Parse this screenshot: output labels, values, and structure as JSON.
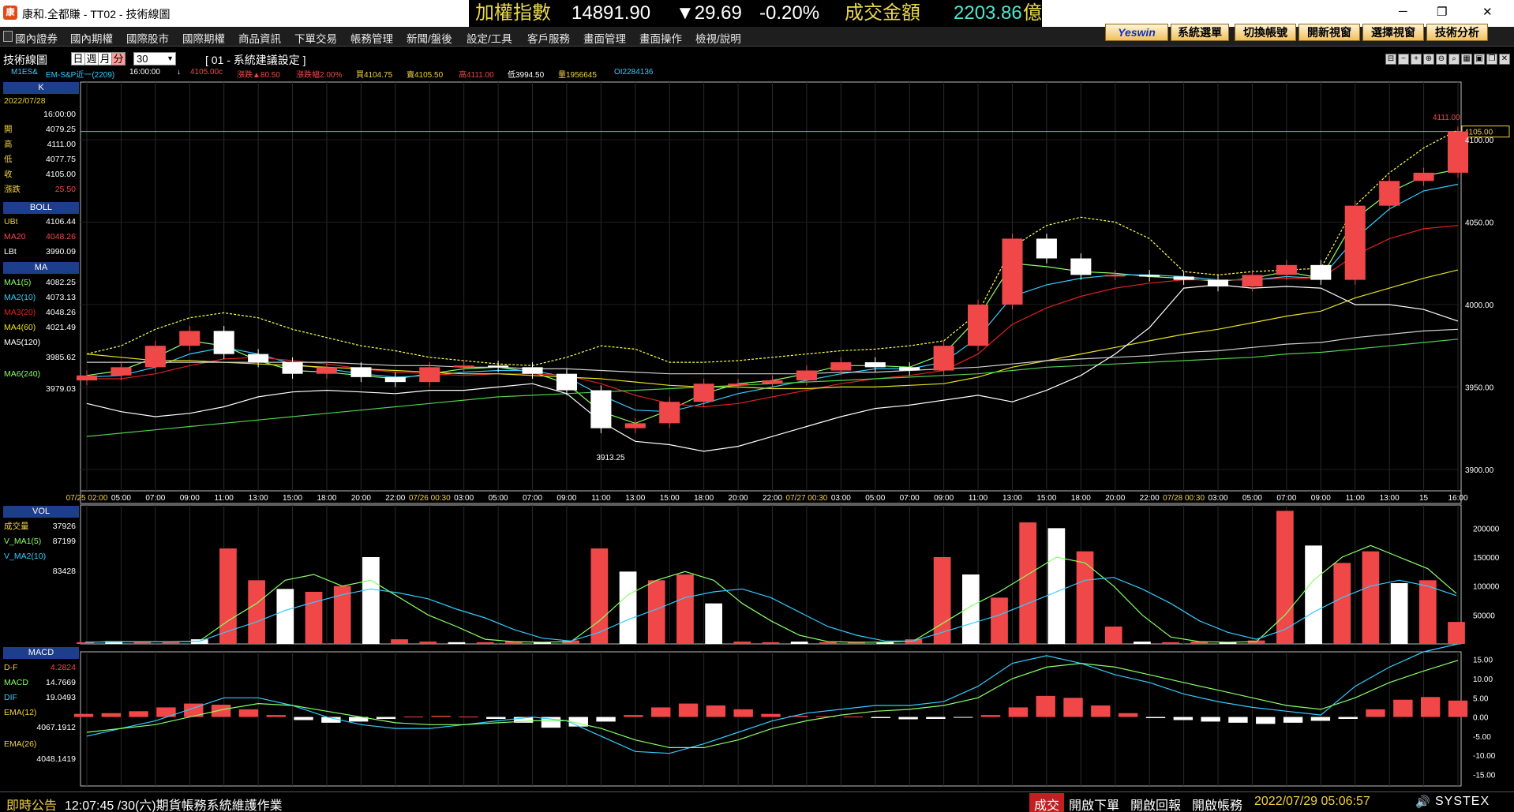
{
  "window": {
    "logo_text": "康",
    "title": "康和.全都賺 - TT02 - 技術線圖",
    "minimize": "─",
    "maximize": "❐",
    "close": "✕"
  },
  "ticker": {
    "index_name": "加權指數",
    "index_value": "14891.90",
    "change": "▼29.69",
    "change_pct": "-0.20%",
    "turnover_label": "成交金額",
    "turnover_value": "2203.86",
    "turnover_unit": "億"
  },
  "menu": [
    "國內證券",
    "國內期權",
    "國際股市",
    "國際期權",
    "商品資訊",
    "下單交易",
    "帳務管理",
    "新聞/盤後",
    "設定/工具",
    "客戶服務",
    "畫面管理",
    "畫面操作",
    "檢視/說明"
  ],
  "toolbar_buttons": [
    "Yeswin",
    "系統選單",
    "切換帳號",
    "開新視窗",
    "選擇視窗",
    "技術分析"
  ],
  "chart_header": {
    "title": "技術線圖",
    "periods": [
      "日",
      "週",
      "月",
      "分"
    ],
    "active_period": "分",
    "interval_value": "30",
    "settings_label": "[ 01 - 系統建議設定 ]"
  },
  "info": {
    "symbol": "M1ES&",
    "name": "EM-S&P近一(2209)",
    "time": "16:00:00",
    "arrow": "↓",
    "price": "4105.00c",
    "change": "漲跌▲80.50",
    "change_pct": "漲跌幅2.00%",
    "bid": "買4104.75",
    "ask": "賣4105.50",
    "high": "高4111.00",
    "low": "低3994.50",
    "volume": "量1956645",
    "oi": "OI2284136"
  },
  "left_panel": {
    "k_header": "K",
    "date": "2022/07/28",
    "time": "16:00:00",
    "ohlc": [
      {
        "k": "開",
        "v": "4079.25"
      },
      {
        "k": "高",
        "v": "4111.00"
      },
      {
        "k": "低",
        "v": "4077.75"
      },
      {
        "k": "收",
        "v": "4105.00"
      },
      {
        "k": "漲跌",
        "v": "25.50"
      }
    ],
    "boll_header": "BOLL",
    "boll": [
      {
        "k": "UBt",
        "v": "4106.44"
      },
      {
        "k": "MA20",
        "v": "4048.26"
      },
      {
        "k": "LBt",
        "v": "3990.09"
      }
    ],
    "ma_header": "MA",
    "ma": [
      {
        "k": "MA1(5)",
        "v": "4082.25"
      },
      {
        "k": "MA2(10)",
        "v": "4073.13"
      },
      {
        "k": "MA3(20)",
        "v": "4048.26"
      },
      {
        "k": "MA4(60)",
        "v": "4021.49"
      },
      {
        "k": "MA5(120)",
        "v": ""
      },
      {
        "k": "",
        "v": "3985.62"
      },
      {
        "k": "MA6(240)",
        "v": ""
      },
      {
        "k": "",
        "v": "3979.03"
      }
    ],
    "vol_header": "VOL",
    "vol": [
      {
        "k": "成交量",
        "v": "37926"
      },
      {
        "k": "V_MA1(5)",
        "v": "87199"
      },
      {
        "k": "V_MA2(10)",
        "v": ""
      },
      {
        "k": "",
        "v": "83428"
      }
    ],
    "macd_header": "MACD",
    "macd": [
      {
        "k": "D-F",
        "v": "4.2824"
      },
      {
        "k": "MACD",
        "v": "14.7669"
      },
      {
        "k": "DIF",
        "v": "19.0493"
      },
      {
        "k": "EMA(12)",
        "v": ""
      },
      {
        "k": "",
        "v": "4067.1912"
      },
      {
        "k": "EMA(26)",
        "v": ""
      },
      {
        "k": "",
        "v": "4048.1419"
      }
    ]
  },
  "chart_data": [
    {
      "type": "candlestick",
      "x": [
        "07/25 02:00",
        "05:00",
        "07:00",
        "09:00",
        "11:00",
        "13:00",
        "15:00",
        "18:00",
        "20:00",
        "22:00",
        "07/26 00:30",
        "03:00",
        "05:00",
        "07:00",
        "09:00",
        "11:00",
        "13:00",
        "15:00",
        "18:00",
        "20:00",
        "22:00",
        "07/27 00:30",
        "03:00",
        "05:00",
        "07:00",
        "09:00",
        "11:00",
        "13:00",
        "15:00",
        "18:00",
        "20:00",
        "22:00",
        "07/28 00:30",
        "03:00",
        "05:00",
        "07:00",
        "09:00",
        "11:00",
        "13:00",
        "15",
        "16:00"
      ],
      "y_ticks": [
        "4100.00",
        "4050.00",
        "4000.00",
        "3950.00",
        "3900.00"
      ],
      "ylim": [
        3887,
        4135
      ],
      "last_price": "4105.00",
      "high_label": "4111.00",
      "low_label": "3913.25",
      "series": [
        {
          "name": "K",
          "values_close": [
            3957,
            3962,
            3975,
            3984,
            3970,
            3965,
            3958,
            3962,
            3956,
            3953,
            3962,
            3963,
            3962,
            3958,
            3948,
            3925,
            3928,
            3941,
            3952,
            3952,
            3954,
            3960,
            3965,
            3962,
            3960,
            3975,
            4000,
            4040,
            4028,
            4018,
            4018,
            4017,
            4015,
            4011,
            4018,
            4024,
            4015,
            4060,
            4075,
            4080,
            4105
          ]
        },
        {
          "name": "MA1(5)",
          "values": [
            3957,
            3960,
            3968,
            3978,
            3975,
            3966,
            3960,
            3959,
            3957,
            3955,
            3958,
            3961,
            3962,
            3959,
            3952,
            3935,
            3928,
            3936,
            3946,
            3952,
            3954,
            3958,
            3963,
            3963,
            3962,
            3970,
            3992,
            4025,
            4023,
            4020,
            4019,
            4017,
            4016,
            4014,
            4016,
            4020,
            4016,
            4052,
            4068,
            4078,
            4082
          ]
        },
        {
          "name": "MA2(10)",
          "values": [
            3956,
            3957,
            3962,
            3970,
            3974,
            3970,
            3964,
            3961,
            3958,
            3956,
            3957,
            3959,
            3960,
            3960,
            3956,
            3945,
            3936,
            3935,
            3940,
            3946,
            3950,
            3954,
            3958,
            3961,
            3961,
            3965,
            3980,
            4005,
            4012,
            4016,
            4018,
            4018,
            4017,
            4015,
            4015,
            4017,
            4016,
            4040,
            4058,
            4069,
            4073
          ]
        },
        {
          "name": "MA3(20)",
          "values": [
            3955,
            3955,
            3958,
            3963,
            3967,
            3968,
            3966,
            3964,
            3961,
            3959,
            3958,
            3957,
            3958,
            3958,
            3957,
            3952,
            3945,
            3940,
            3938,
            3940,
            3944,
            3948,
            3952,
            3955,
            3957,
            3960,
            3970,
            3988,
            3998,
            4005,
            4010,
            4013,
            4015,
            4015,
            4015,
            4016,
            4016,
            4030,
            4040,
            4046,
            4048
          ]
        },
        {
          "name": "MA4(60)",
          "values": [
            3970,
            3968,
            3966,
            3966,
            3965,
            3964,
            3963,
            3962,
            3961,
            3960,
            3959,
            3958,
            3958,
            3957,
            3956,
            3955,
            3953,
            3951,
            3950,
            3950,
            3949,
            3949,
            3950,
            3950,
            3951,
            3952,
            3956,
            3962,
            3966,
            3970,
            3974,
            3978,
            3982,
            3985,
            3989,
            3993,
            3996,
            4004,
            4010,
            4016,
            4021
          ]
        },
        {
          "name": "MA5(120)",
          "values": [
            3965,
            3965,
            3965,
            3965,
            3965,
            3965,
            3965,
            3965,
            3964,
            3963,
            3963,
            3962,
            3962,
            3961,
            3961,
            3960,
            3959,
            3958,
            3958,
            3958,
            3958,
            3958,
            3959,
            3959,
            3960,
            3961,
            3962,
            3964,
            3966,
            3967,
            3968,
            3969,
            3971,
            3972,
            3974,
            3976,
            3977,
            3980,
            3982,
            3984,
            3985
          ]
        },
        {
          "name": "MA6(240)",
          "values": [
            3920,
            3922,
            3924,
            3926,
            3928,
            3930,
            3932,
            3934,
            3936,
            3938,
            3940,
            3942,
            3944,
            3945,
            3946,
            3947,
            3948,
            3949,
            3950,
            3951,
            3952,
            3953,
            3954,
            3955,
            3956,
            3957,
            3958,
            3960,
            3962,
            3963,
            3964,
            3965,
            3966,
            3967,
            3968,
            3970,
            3971,
            3973,
            3975,
            3977,
            3979
          ]
        },
        {
          "name": "UBt",
          "values": [
            3970,
            3975,
            3985,
            3992,
            3995,
            3992,
            3985,
            3980,
            3975,
            3972,
            3968,
            3966,
            3964,
            3963,
            3968,
            3975,
            3973,
            3965,
            3965,
            3966,
            3968,
            3970,
            3972,
            3973,
            3975,
            3978,
            3995,
            4035,
            4048,
            4053,
            4050,
            4040,
            4020,
            4018,
            4020,
            4021,
            4022,
            4060,
            4080,
            4095,
            4106
          ]
        },
        {
          "name": "LBt",
          "values": [
            3940,
            3935,
            3932,
            3934,
            3938,
            3944,
            3947,
            3948,
            3947,
            3946,
            3948,
            3948,
            3950,
            3952,
            3946,
            3929,
            3917,
            3915,
            3911,
            3914,
            3920,
            3926,
            3932,
            3937,
            3939,
            3942,
            3945,
            3941,
            3948,
            3957,
            3970,
            3986,
            4010,
            4012,
            4010,
            4011,
            4010,
            4000,
            4000,
            3997,
            3990
          ]
        }
      ]
    },
    {
      "type": "bar",
      "name": "VOL",
      "y_ticks": [
        "200000",
        "150000",
        "100000",
        "50000"
      ],
      "ylim": [
        0,
        240000
      ],
      "values": [
        3000,
        5000,
        4000,
        3000,
        8000,
        165000,
        110000,
        95000,
        90000,
        100000,
        150000,
        8000,
        4000,
        3000,
        3000,
        4000,
        3000,
        6000,
        165000,
        125000,
        110000,
        120000,
        70000,
        4000,
        3000,
        4000,
        3000,
        3000,
        3000,
        8000,
        150000,
        120000,
        80000,
        210000,
        200000,
        160000,
        30000,
        4000,
        3000,
        4000,
        3000,
        6000,
        230000,
        170000,
        140000,
        160000,
        105000,
        110000,
        38000
      ],
      "series": [
        {
          "name": "V_MA1(5)",
          "values": [
            3000,
            4000,
            4000,
            4000,
            5000,
            40000,
            70000,
            110000,
            120000,
            100000,
            110000,
            80000,
            50000,
            30000,
            8000,
            4000,
            3000,
            4000,
            40000,
            85000,
            110000,
            125000,
            110000,
            70000,
            40000,
            15000,
            4000,
            3000,
            3000,
            5000,
            35000,
            65000,
            90000,
            120000,
            150000,
            140000,
            100000,
            50000,
            12000,
            4000,
            3000,
            4000,
            50000,
            110000,
            150000,
            170000,
            150000,
            130000,
            87199
          ]
        },
        {
          "name": "V_MA2(10)",
          "values": [
            3000,
            3500,
            3800,
            4000,
            4500,
            22000,
            38000,
            58000,
            72000,
            85000,
            95000,
            88000,
            78000,
            60000,
            45000,
            25000,
            10000,
            5000,
            20000,
            42000,
            60000,
            80000,
            90000,
            95000,
            80000,
            55000,
            30000,
            15000,
            5000,
            5000,
            20000,
            35000,
            50000,
            70000,
            90000,
            110000,
            115000,
            95000,
            70000,
            40000,
            20000,
            8000,
            25000,
            55000,
            80000,
            100000,
            110000,
            100000,
            83428
          ]
        }
      ]
    },
    {
      "type": "bar",
      "name": "MACD",
      "y_ticks": [
        "15.00",
        "10.00",
        "5.00",
        "0.00",
        "-5.00",
        "-10.00",
        "-15.00"
      ],
      "ylim": [
        -18,
        17
      ],
      "values": [
        0.8,
        1.0,
        1.5,
        2.5,
        3.5,
        3.2,
        2.0,
        0.5,
        -0.8,
        -1.5,
        -1.2,
        -0.5,
        0.1,
        0.3,
        0.1,
        -0.5,
        -1.5,
        -2.8,
        -2.5,
        -1.2,
        0.5,
        2.5,
        3.5,
        3.0,
        2.0,
        0.8,
        0.3,
        0.2,
        0.1,
        -0.3,
        -0.6,
        -0.5,
        -0.2,
        0.5,
        2.5,
        5.5,
        5.0,
        3.0,
        1.0,
        -0.3,
        -0.8,
        -1.2,
        -1.5,
        -1.8,
        -1.5,
        -1.0,
        -0.5,
        2.0,
        4.5,
        5.2,
        4.28
      ],
      "series": [
        {
          "name": "DIF",
          "values": [
            -5,
            -3,
            -1,
            2,
            5,
            5,
            3,
            0,
            -2,
            -3,
            -3,
            -2,
            -1,
            0,
            -1,
            -5,
            -9,
            -9.5,
            -7,
            -4,
            -1,
            1,
            2,
            3,
            3,
            4,
            8,
            14,
            16,
            14,
            11,
            9,
            6,
            4,
            2.5,
            1.5,
            0.5,
            8,
            13,
            17,
            19.05
          ]
        },
        {
          "name": "MACD",
          "values": [
            -4,
            -3,
            -2,
            0,
            2,
            3.5,
            3,
            1.5,
            0,
            -1.5,
            -2,
            -2,
            -1.5,
            -1,
            -1,
            -3,
            -6,
            -8,
            -8,
            -6,
            -3,
            -1,
            0.5,
            1.5,
            2,
            3,
            5,
            10,
            13,
            14,
            13,
            11,
            9,
            7,
            5,
            3,
            2,
            5,
            9,
            12,
            14.77
          ]
        }
      ]
    }
  ],
  "status": {
    "label": "即時公告",
    "message": "12:07:45 /30(六)期貨帳務系統維護作業",
    "btn_trade": "成交",
    "btn_order": "開啟下單",
    "btn_report": "開啟回報",
    "btn_account": "開啟帳務",
    "datetime": "2022/07/29 05:06:57",
    "brand": "SYSTEX"
  },
  "colors": {
    "up": "#f04848",
    "down": "#ffffff",
    "ma1": "#88ff66",
    "ma2": "#33ccff",
    "ma3": "#e02020",
    "ma4": "#e8e020",
    "ma5": "#cfcfcf",
    "ma6": "#50d050",
    "boll": "#ffff50",
    "lbt": "#ffffff"
  }
}
